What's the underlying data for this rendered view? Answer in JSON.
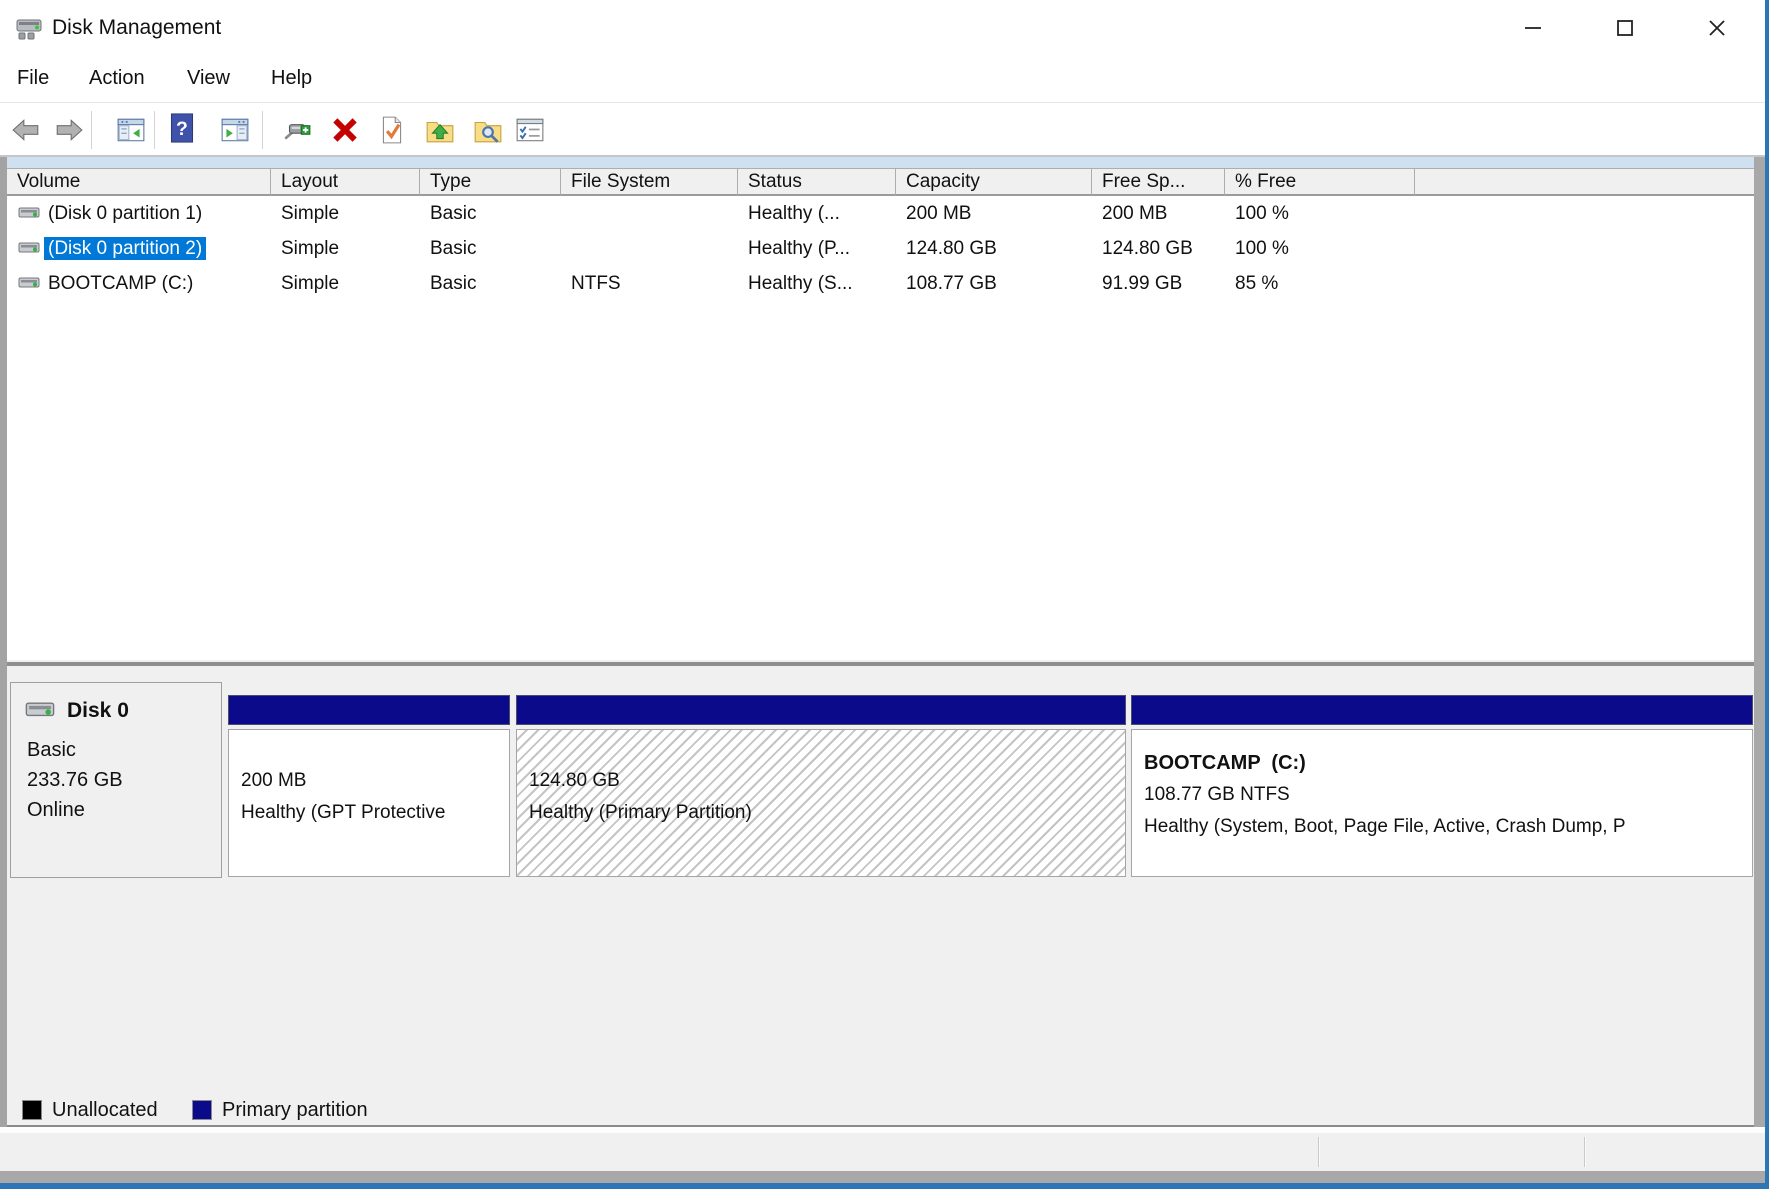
{
  "window": {
    "title": "Disk Management"
  },
  "menu": {
    "items": [
      "File",
      "Action",
      "View",
      "Help"
    ]
  },
  "toolbar": {
    "icons": [
      "back",
      "forward",
      "show-console-tree",
      "help",
      "show-action-pane",
      "rescan-disks",
      "delete-volume",
      "check-document",
      "folder-up",
      "folder-search",
      "properties"
    ]
  },
  "volume_list": {
    "columns": [
      "Volume",
      "Layout",
      "Type",
      "File System",
      "Status",
      "Capacity",
      "Free Sp...",
      "% Free"
    ],
    "rows": [
      {
        "volume": "(Disk 0 partition 1)",
        "layout": "Simple",
        "type": "Basic",
        "file_system": "",
        "status": "Healthy (...",
        "capacity": "200 MB",
        "free_space": "200 MB",
        "pct_free": "100 %"
      },
      {
        "volume": "(Disk 0 partition 2)",
        "layout": "Simple",
        "type": "Basic",
        "file_system": "",
        "status": "Healthy (P...",
        "capacity": "124.80 GB",
        "free_space": "124.80 GB",
        "pct_free": "100 %"
      },
      {
        "volume": "BOOTCAMP (C:)",
        "layout": "Simple",
        "type": "Basic",
        "file_system": "NTFS",
        "status": "Healthy (S...",
        "capacity": "108.77 GB",
        "free_space": "91.99 GB",
        "pct_free": "85 %"
      }
    ]
  },
  "disk": {
    "name": "Disk 0",
    "kind": "Basic",
    "size": "233.76 GB",
    "state": "Online",
    "partitions": [
      {
        "size": "200 MB",
        "status": "Healthy (GPT Protective"
      },
      {
        "size": "124.80 GB",
        "status": "Healthy (Primary Partition)"
      },
      {
        "label": "BOOTCAMP  (C:)",
        "size": "108.77 GB NTFS",
        "status": "Healthy (System, Boot, Page File, Active, Crash Dump, P"
      }
    ]
  },
  "legend": {
    "items": [
      {
        "label": "Unallocated",
        "color": "#000000"
      },
      {
        "label": "Primary partition",
        "color": "#0a0a8a"
      }
    ]
  },
  "colors": {
    "selection": "#0078d7",
    "partition_bar": "#0a0a8a",
    "window_border": "#2e75b6",
    "list_header_strip": "#cfe0f1"
  }
}
